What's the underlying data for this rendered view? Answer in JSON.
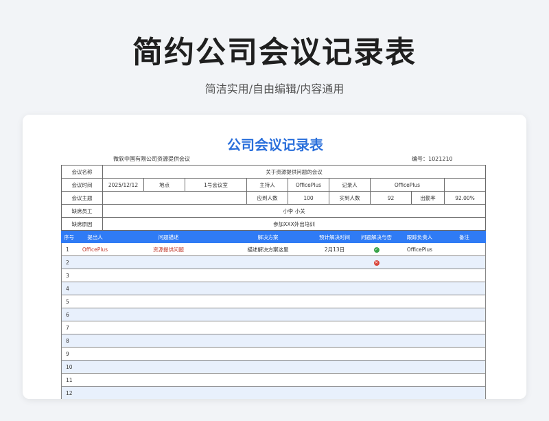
{
  "hero": {
    "title": "简约公司会议记录表",
    "subtitle": "简洁实用/自由编辑/内容通用"
  },
  "doc": {
    "title": "公司会议记录表",
    "org": "微软中国有限公司资源提供会议",
    "number_label": "编号：",
    "number": "1021210"
  },
  "info": {
    "meeting_name_label": "会议名称",
    "meeting_name": "关于资源提供问题的会议",
    "time_label": "会议时间",
    "time": "2025/12/12",
    "place_label": "地点",
    "place": "1号会议室",
    "host_label": "主持人",
    "host": "OfficePlus",
    "recorder_label": "记录人",
    "recorder": "OfficePlus",
    "topic_label": "会议主题",
    "topic": "",
    "expected_label": "应到人数",
    "expected": "100",
    "actual_label": "实到人数",
    "actual": "92",
    "rate_label": "出勤率",
    "rate": "92.00%",
    "absent_label": "缺席员工",
    "absent": "小李 小关",
    "reason_label": "缺席原因",
    "reason": "参加XXX外出培训"
  },
  "table": {
    "headers": [
      "序号",
      "提出人",
      "问题描述",
      "解决方案",
      "预计解决时间",
      "问题解决与否",
      "跟踪负责人",
      "备注"
    ],
    "rows": [
      {
        "no": "1",
        "proposer": "OfficePlus",
        "issue": "资源提供问题",
        "solution": "描述解决方案这里",
        "due": "2月13日",
        "resolved": "yes",
        "owner": "OfficePlus",
        "note": ""
      },
      {
        "no": "2",
        "proposer": "",
        "issue": "",
        "solution": "",
        "due": "",
        "resolved": "no",
        "owner": "",
        "note": ""
      },
      {
        "no": "3",
        "proposer": "",
        "issue": "",
        "solution": "",
        "due": "",
        "resolved": "",
        "owner": "",
        "note": ""
      },
      {
        "no": "4",
        "proposer": "",
        "issue": "",
        "solution": "",
        "due": "",
        "resolved": "",
        "owner": "",
        "note": ""
      },
      {
        "no": "5",
        "proposer": "",
        "issue": "",
        "solution": "",
        "due": "",
        "resolved": "",
        "owner": "",
        "note": ""
      },
      {
        "no": "6",
        "proposer": "",
        "issue": "",
        "solution": "",
        "due": "",
        "resolved": "",
        "owner": "",
        "note": ""
      },
      {
        "no": "7",
        "proposer": "",
        "issue": "",
        "solution": "",
        "due": "",
        "resolved": "",
        "owner": "",
        "note": ""
      },
      {
        "no": "8",
        "proposer": "",
        "issue": "",
        "solution": "",
        "due": "",
        "resolved": "",
        "owner": "",
        "note": ""
      },
      {
        "no": "9",
        "proposer": "",
        "issue": "",
        "solution": "",
        "due": "",
        "resolved": "",
        "owner": "",
        "note": ""
      },
      {
        "no": "10",
        "proposer": "",
        "issue": "",
        "solution": "",
        "due": "",
        "resolved": "",
        "owner": "",
        "note": ""
      },
      {
        "no": "11",
        "proposer": "",
        "issue": "",
        "solution": "",
        "due": "",
        "resolved": "",
        "owner": "",
        "note": ""
      },
      {
        "no": "12",
        "proposer": "",
        "issue": "",
        "solution": "",
        "due": "",
        "resolved": "",
        "owner": "",
        "note": ""
      }
    ]
  },
  "colors": {
    "accent": "#2f7bf5",
    "title_blue": "#2a6fdb",
    "alt_row": "#e8f0fc",
    "resolved_yes": "#3aa44a",
    "resolved_no": "#d9453a"
  }
}
